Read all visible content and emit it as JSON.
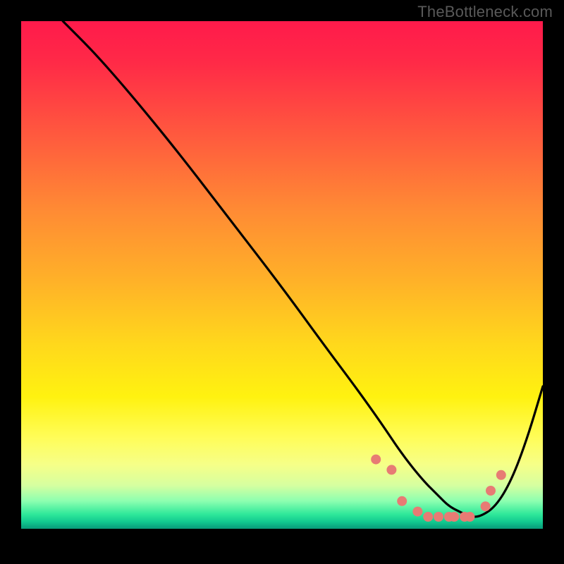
{
  "watermark": "TheBottleneck.com",
  "chart_data": {
    "type": "line",
    "title": "",
    "xlabel": "",
    "ylabel": "",
    "xlim": [
      0,
      100
    ],
    "ylim": [
      0,
      100
    ],
    "grid": false,
    "legend": false,
    "series": [
      {
        "name": "curve",
        "color": "#000000",
        "x": [
          8,
          14,
          21,
          30,
          40,
          50,
          58,
          64,
          69,
          73,
          77,
          80,
          82,
          84,
          86,
          88,
          91,
          94,
          97,
          100
        ],
        "y": [
          100,
          94,
          86,
          75,
          62,
          49,
          38,
          30,
          23,
          17,
          12,
          9,
          7,
          6,
          5,
          5,
          7,
          12,
          20,
          30
        ]
      }
    ],
    "markers": {
      "name": "dots",
      "color": "#e77b74",
      "radius_px": 7,
      "x": [
        68,
        71,
        73,
        76,
        78,
        80,
        82,
        83,
        85,
        86,
        89,
        90,
        92
      ],
      "y": [
        16,
        14,
        8,
        6,
        5,
        5,
        5,
        5,
        5,
        5,
        7,
        10,
        13
      ]
    },
    "background_gradient": {
      "top": "#ff1a4b",
      "mid": "#ffd81c",
      "green_band": "#2fe89a",
      "bottom_edge": "#000000"
    }
  }
}
